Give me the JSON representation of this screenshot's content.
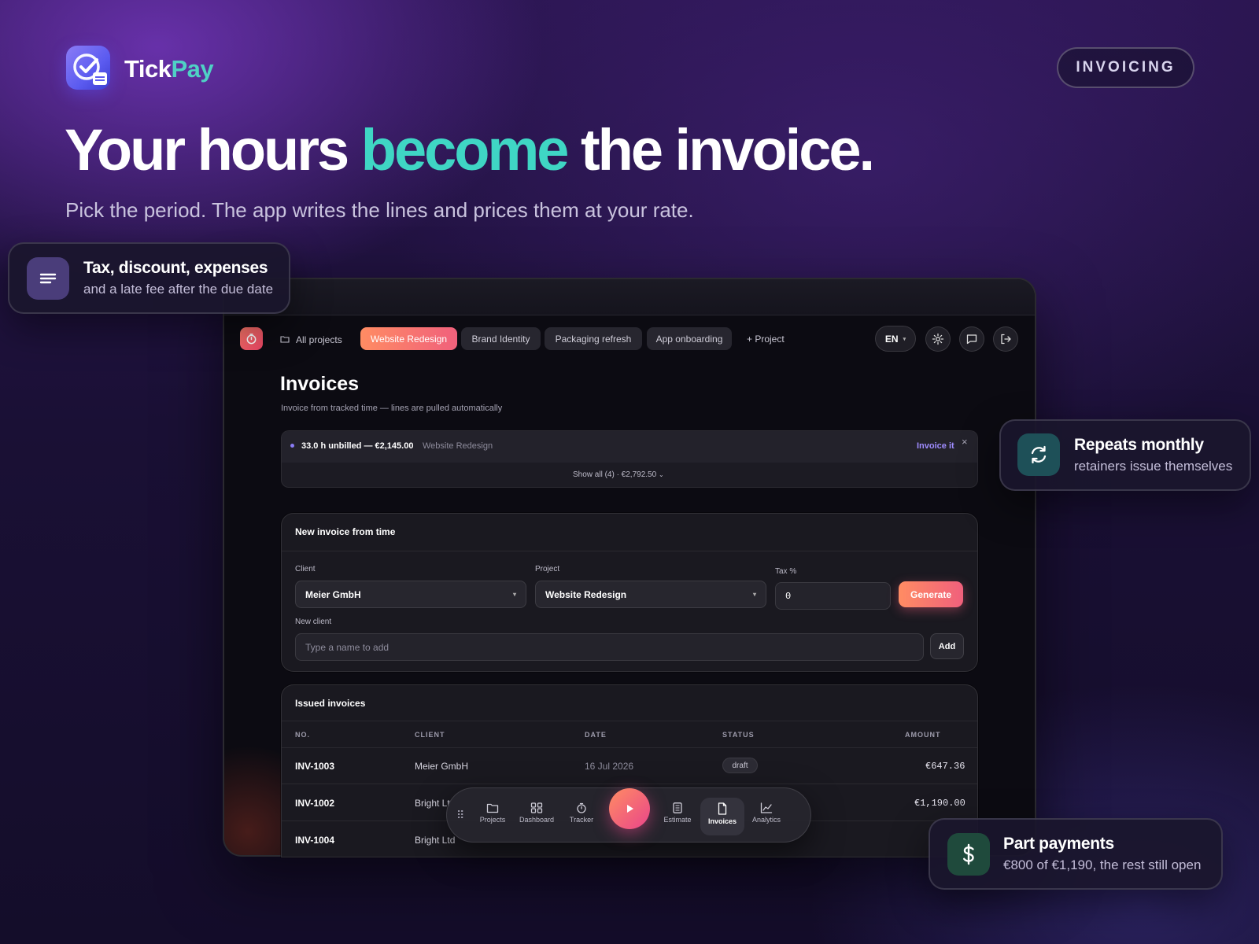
{
  "brand": {
    "name_part1": "Tick",
    "name_part2": "Pay"
  },
  "badge": "INVOICING",
  "headline": {
    "part1": "Your hours ",
    "accent": "become",
    "part2": " the invoice."
  },
  "subhead": "Pick the period. The app writes the lines and prices them at your rate.",
  "features": [
    {
      "title": "Tax, discount, expenses",
      "subtitle": "and a late fee after the due date",
      "icon": "lines-icon"
    },
    {
      "title": "Repeats monthly",
      "subtitle": "retainers issue themselves",
      "icon": "refresh-icon"
    },
    {
      "title": "Part payments",
      "subtitle": "€800 of €1,190, the rest still open",
      "icon": "dollar-icon"
    }
  ],
  "nav": {
    "all_projects": "All projects",
    "tabs": [
      "Website Redesign",
      "Brand Identity",
      "Packaging refresh",
      "App onboarding"
    ],
    "active_tab": "Website Redesign",
    "add_project": "+ Project",
    "language": "EN"
  },
  "page": {
    "title": "Invoices",
    "subtitle": "Invoice from tracked time — lines are pulled automatically"
  },
  "unbilled": {
    "summary": "33.0 h unbilled — €2,145.00",
    "project": "Website Redesign",
    "action": "Invoice it",
    "close": "×",
    "show_all": "Show all (4) · €2,792.50"
  },
  "new_invoice": {
    "title": "New invoice from time",
    "client_label": "Client",
    "client_value": "Meier GmbH",
    "project_label": "Project",
    "project_value": "Website Redesign",
    "tax_label": "Tax %",
    "tax_value": "0",
    "generate": "Generate",
    "new_client_label": "New client",
    "new_client_placeholder": "Type a name to add",
    "add": "Add"
  },
  "issued": {
    "title": "Issued invoices",
    "columns": [
      "NO.",
      "CLIENT",
      "DATE",
      "STATUS",
      "AMOUNT"
    ],
    "rows": [
      {
        "no": "INV-1003",
        "client": "Meier GmbH",
        "date": "16 Jul 2026",
        "status": "draft",
        "amount": "€647.36"
      },
      {
        "no": "INV-1002",
        "client": "Bright Lt",
        "amount": "€1,190.00"
      },
      {
        "no": "INV-1004",
        "client": "Bright Ltd"
      }
    ]
  },
  "dock": [
    "Projects",
    "Dashboard",
    "Tracker",
    "Estimate",
    "Invoices",
    "Analytics"
  ],
  "colors": {
    "accent_teal": "#3fd6c4",
    "accent_coral": "#ff8c63",
    "accent_pink": "#f0607c",
    "accent_violet": "#9f8cff"
  }
}
